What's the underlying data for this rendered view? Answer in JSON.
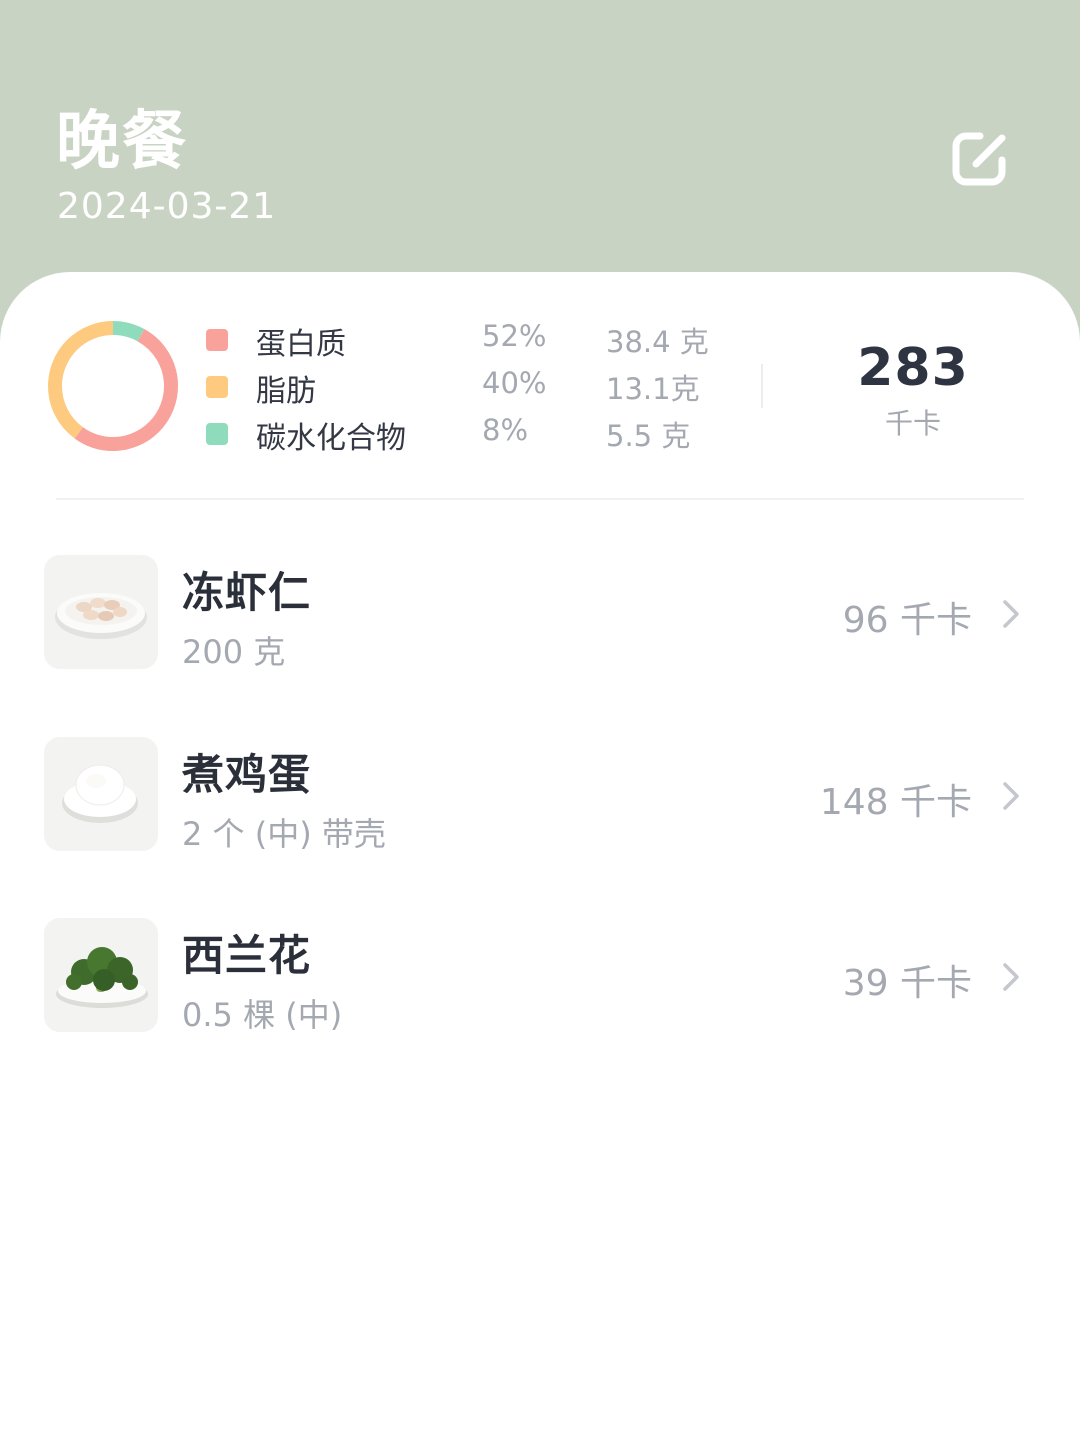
{
  "header": {
    "title": "晚餐",
    "date": "2024-03-21"
  },
  "icons": {
    "edit": "edit-icon",
    "chevron": "chevron-right-icon"
  },
  "nutrition": {
    "macros": [
      {
        "name": "蛋白质",
        "percent": "52%",
        "grams": "38.4 克",
        "color": "#f9a29b"
      },
      {
        "name": "脂肪",
        "percent": "40%",
        "grams": "13.1克",
        "color": "#fdca80"
      },
      {
        "name": "碳水化合物",
        "percent": "8%",
        "grams": "5.5 克",
        "color": "#8fdcbc"
      }
    ],
    "total_kcal": "283",
    "kcal_unit": "千卡"
  },
  "foods": [
    {
      "name": "冻虾仁",
      "amount": "200 克",
      "kcal": "96 千卡",
      "image": "shrimp-plate"
    },
    {
      "name": "煮鸡蛋",
      "amount": "2 个 (中) 带壳",
      "kcal": "148 千卡",
      "image": "boiled-egg"
    },
    {
      "name": "西兰花",
      "amount": "0.5 棵 (中)",
      "kcal": "39 千卡",
      "image": "broccoli"
    }
  ],
  "colors": {
    "header_bg": "#c9d3c3",
    "title_text": "#2a2f3a",
    "muted_text": "#a4a8b0"
  }
}
